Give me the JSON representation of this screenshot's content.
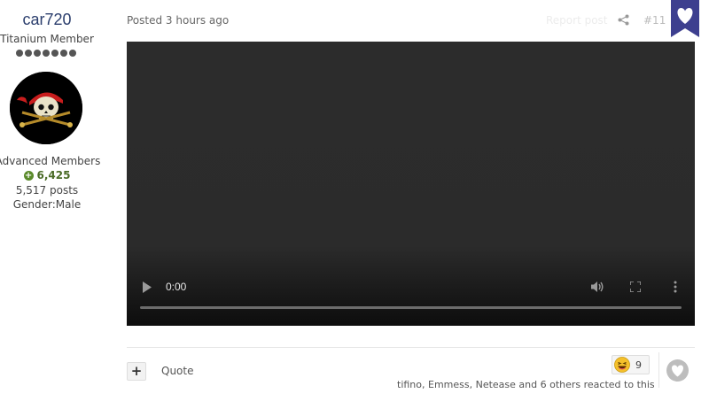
{
  "author": {
    "name": "car720",
    "rank": "Titanium Member",
    "pips": 7,
    "group": "Advanced Members",
    "reputation": "6,425",
    "posts": "5,517 posts",
    "gender": "Gender:Male",
    "avatar_icon": "pirate-skull-icon"
  },
  "post": {
    "posted": "Posted 3 hours ago",
    "report": "Report post",
    "number": "#11"
  },
  "video": {
    "time": "0:00",
    "progress": 0
  },
  "footer": {
    "plus_label": "+",
    "quote_label": "Quote",
    "reaction_count": "9",
    "reacted_text": "tifino, Emmess, Netease and 6 others reacted to this"
  },
  "colors": {
    "accent": "#3d3f8f",
    "username": "#2b3e6d",
    "reputation": "#4a6b26"
  }
}
